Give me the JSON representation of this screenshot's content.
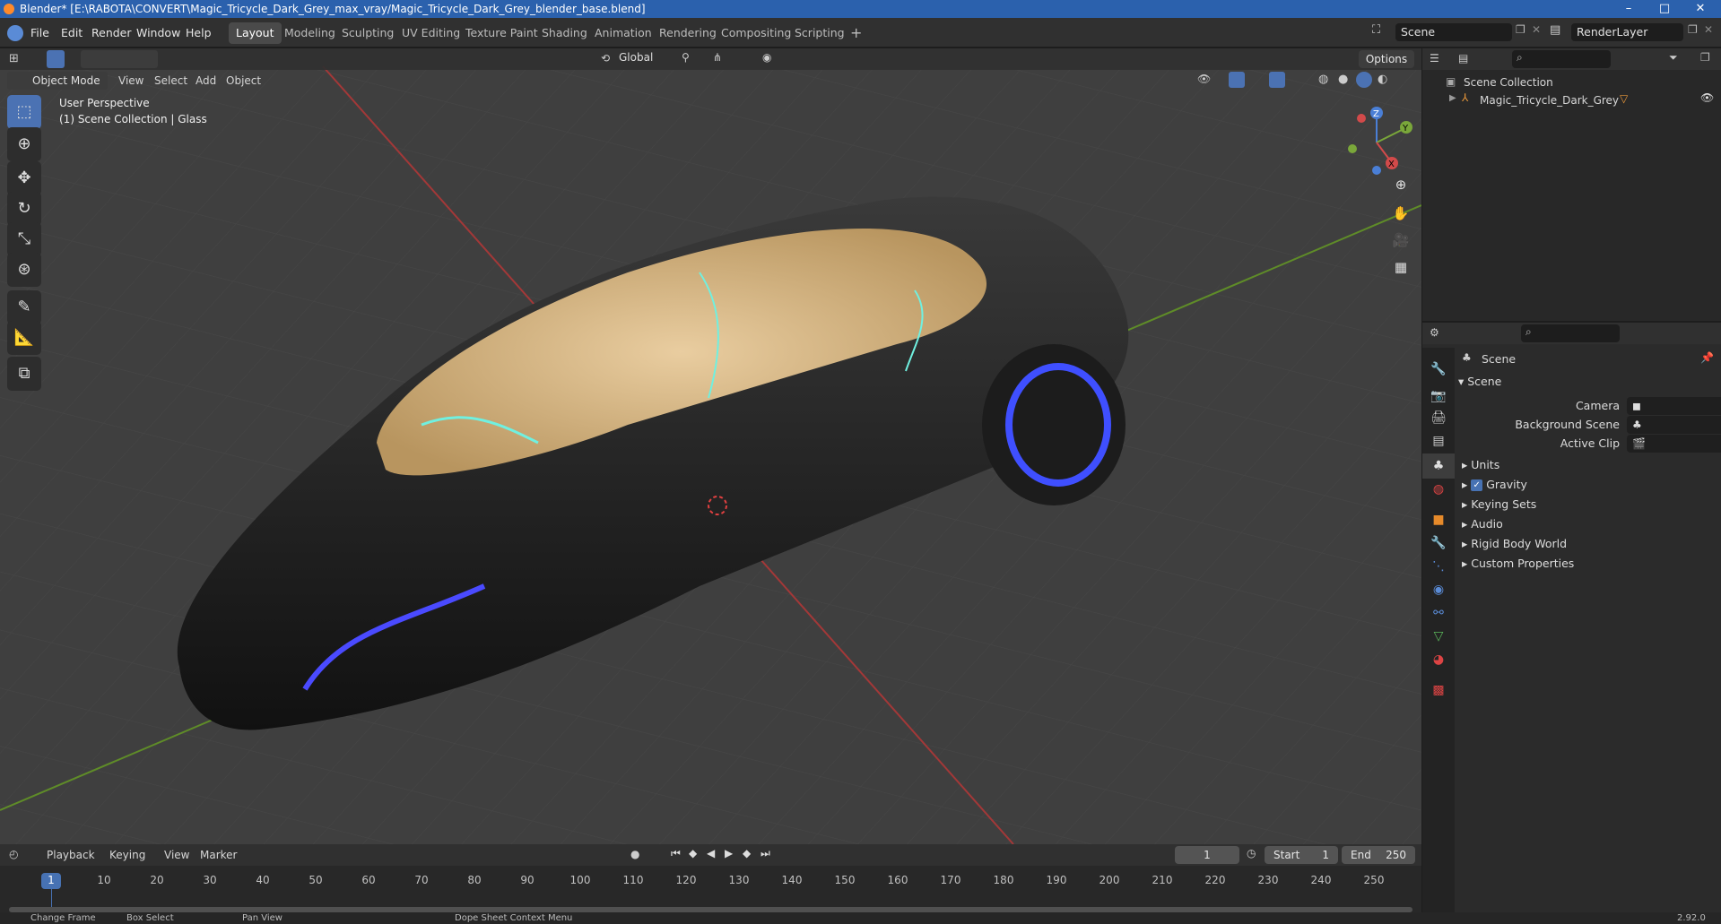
{
  "window": {
    "title": "Blender* [E:\\RABOTA\\CONVERT\\Magic_Tricycle_Dark_Grey_max_vray/Magic_Tricycle_Dark_Grey_blender_base.blend]",
    "minimize": "–",
    "maximize": "□",
    "close": "✕"
  },
  "menu": [
    "File",
    "Edit",
    "Render",
    "Window",
    "Help"
  ],
  "workspaces": [
    "Layout",
    "Modeling",
    "Sculpting",
    "UV Editing",
    "Texture Paint",
    "Shading",
    "Animation",
    "Rendering",
    "Compositing",
    "Scripting"
  ],
  "active_workspace": "Layout",
  "add_workspace": "+",
  "scene_field": "Scene",
  "renderlayer_field": "RenderLayer",
  "viewport_header": {
    "transform_orientation": "Global",
    "options": "Options",
    "mode": "Object Mode",
    "menus": [
      "View",
      "Select",
      "Add",
      "Object"
    ]
  },
  "viewport_overlay": {
    "perspective": "User Perspective",
    "collection_info": "(1) Scene Collection | Glass"
  },
  "gizmo": {
    "z": "Z",
    "y": "Y",
    "x": "X"
  },
  "timeline": {
    "menus": [
      "Playback",
      "Keying",
      "View",
      "Marker"
    ],
    "current_frame": "1",
    "start_label": "Start",
    "start_value": "1",
    "end_label": "End",
    "end_value": "250",
    "ticks": [
      "1",
      "10",
      "20",
      "30",
      "40",
      "50",
      "60",
      "70",
      "80",
      "90",
      "100",
      "110",
      "120",
      "130",
      "140",
      "150",
      "160",
      "170",
      "180",
      "190",
      "200",
      "210",
      "220",
      "230",
      "240",
      "250"
    ]
  },
  "outliner": {
    "root": "Scene Collection",
    "items": [
      "Magic_Tricycle_Dark_Grey"
    ]
  },
  "properties": {
    "header": "Scene",
    "panel": "Scene",
    "fields": [
      {
        "label": "Camera",
        "value": ""
      },
      {
        "label": "Background Scene",
        "value": ""
      },
      {
        "label": "Active Clip",
        "value": ""
      }
    ],
    "subpanels": [
      "Units",
      "Gravity",
      "Keying Sets",
      "Audio",
      "Rigid Body World",
      "Custom Properties"
    ],
    "gravity_checked": true
  },
  "statusbar": {
    "items": [
      "Change Frame",
      "Box Select",
      "Pan View",
      "Dope Sheet Context Menu"
    ],
    "version": "2.92.0"
  },
  "colors": {
    "accent": "#4772b3",
    "car_body": "#1b1b1b",
    "interior": "#d9b98a",
    "neon": "#3f4fff",
    "x_axis": "#b53a3a",
    "y_axis": "#6a9a2a"
  }
}
